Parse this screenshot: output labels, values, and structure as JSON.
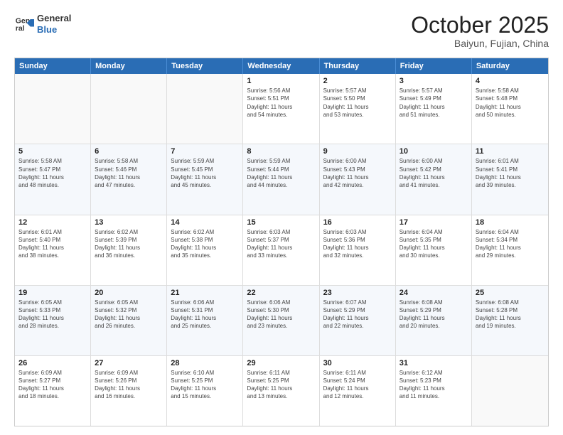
{
  "header": {
    "logo_line1": "General",
    "logo_line2": "Blue",
    "month": "October 2025",
    "location": "Baiyun, Fujian, China"
  },
  "weekdays": [
    "Sunday",
    "Monday",
    "Tuesday",
    "Wednesday",
    "Thursday",
    "Friday",
    "Saturday"
  ],
  "rows": [
    [
      {
        "date": "",
        "info": ""
      },
      {
        "date": "",
        "info": ""
      },
      {
        "date": "",
        "info": ""
      },
      {
        "date": "1",
        "info": "Sunrise: 5:56 AM\nSunset: 5:51 PM\nDaylight: 11 hours\nand 54 minutes."
      },
      {
        "date": "2",
        "info": "Sunrise: 5:57 AM\nSunset: 5:50 PM\nDaylight: 11 hours\nand 53 minutes."
      },
      {
        "date": "3",
        "info": "Sunrise: 5:57 AM\nSunset: 5:49 PM\nDaylight: 11 hours\nand 51 minutes."
      },
      {
        "date": "4",
        "info": "Sunrise: 5:58 AM\nSunset: 5:48 PM\nDaylight: 11 hours\nand 50 minutes."
      }
    ],
    [
      {
        "date": "5",
        "info": "Sunrise: 5:58 AM\nSunset: 5:47 PM\nDaylight: 11 hours\nand 48 minutes."
      },
      {
        "date": "6",
        "info": "Sunrise: 5:58 AM\nSunset: 5:46 PM\nDaylight: 11 hours\nand 47 minutes."
      },
      {
        "date": "7",
        "info": "Sunrise: 5:59 AM\nSunset: 5:45 PM\nDaylight: 11 hours\nand 45 minutes."
      },
      {
        "date": "8",
        "info": "Sunrise: 5:59 AM\nSunset: 5:44 PM\nDaylight: 11 hours\nand 44 minutes."
      },
      {
        "date": "9",
        "info": "Sunrise: 6:00 AM\nSunset: 5:43 PM\nDaylight: 11 hours\nand 42 minutes."
      },
      {
        "date": "10",
        "info": "Sunrise: 6:00 AM\nSunset: 5:42 PM\nDaylight: 11 hours\nand 41 minutes."
      },
      {
        "date": "11",
        "info": "Sunrise: 6:01 AM\nSunset: 5:41 PM\nDaylight: 11 hours\nand 39 minutes."
      }
    ],
    [
      {
        "date": "12",
        "info": "Sunrise: 6:01 AM\nSunset: 5:40 PM\nDaylight: 11 hours\nand 38 minutes."
      },
      {
        "date": "13",
        "info": "Sunrise: 6:02 AM\nSunset: 5:39 PM\nDaylight: 11 hours\nand 36 minutes."
      },
      {
        "date": "14",
        "info": "Sunrise: 6:02 AM\nSunset: 5:38 PM\nDaylight: 11 hours\nand 35 minutes."
      },
      {
        "date": "15",
        "info": "Sunrise: 6:03 AM\nSunset: 5:37 PM\nDaylight: 11 hours\nand 33 minutes."
      },
      {
        "date": "16",
        "info": "Sunrise: 6:03 AM\nSunset: 5:36 PM\nDaylight: 11 hours\nand 32 minutes."
      },
      {
        "date": "17",
        "info": "Sunrise: 6:04 AM\nSunset: 5:35 PM\nDaylight: 11 hours\nand 30 minutes."
      },
      {
        "date": "18",
        "info": "Sunrise: 6:04 AM\nSunset: 5:34 PM\nDaylight: 11 hours\nand 29 minutes."
      }
    ],
    [
      {
        "date": "19",
        "info": "Sunrise: 6:05 AM\nSunset: 5:33 PM\nDaylight: 11 hours\nand 28 minutes."
      },
      {
        "date": "20",
        "info": "Sunrise: 6:05 AM\nSunset: 5:32 PM\nDaylight: 11 hours\nand 26 minutes."
      },
      {
        "date": "21",
        "info": "Sunrise: 6:06 AM\nSunset: 5:31 PM\nDaylight: 11 hours\nand 25 minutes."
      },
      {
        "date": "22",
        "info": "Sunrise: 6:06 AM\nSunset: 5:30 PM\nDaylight: 11 hours\nand 23 minutes."
      },
      {
        "date": "23",
        "info": "Sunrise: 6:07 AM\nSunset: 5:29 PM\nDaylight: 11 hours\nand 22 minutes."
      },
      {
        "date": "24",
        "info": "Sunrise: 6:08 AM\nSunset: 5:29 PM\nDaylight: 11 hours\nand 20 minutes."
      },
      {
        "date": "25",
        "info": "Sunrise: 6:08 AM\nSunset: 5:28 PM\nDaylight: 11 hours\nand 19 minutes."
      }
    ],
    [
      {
        "date": "26",
        "info": "Sunrise: 6:09 AM\nSunset: 5:27 PM\nDaylight: 11 hours\nand 18 minutes."
      },
      {
        "date": "27",
        "info": "Sunrise: 6:09 AM\nSunset: 5:26 PM\nDaylight: 11 hours\nand 16 minutes."
      },
      {
        "date": "28",
        "info": "Sunrise: 6:10 AM\nSunset: 5:25 PM\nDaylight: 11 hours\nand 15 minutes."
      },
      {
        "date": "29",
        "info": "Sunrise: 6:11 AM\nSunset: 5:25 PM\nDaylight: 11 hours\nand 13 minutes."
      },
      {
        "date": "30",
        "info": "Sunrise: 6:11 AM\nSunset: 5:24 PM\nDaylight: 11 hours\nand 12 minutes."
      },
      {
        "date": "31",
        "info": "Sunrise: 6:12 AM\nSunset: 5:23 PM\nDaylight: 11 hours\nand 11 minutes."
      },
      {
        "date": "",
        "info": ""
      }
    ]
  ]
}
